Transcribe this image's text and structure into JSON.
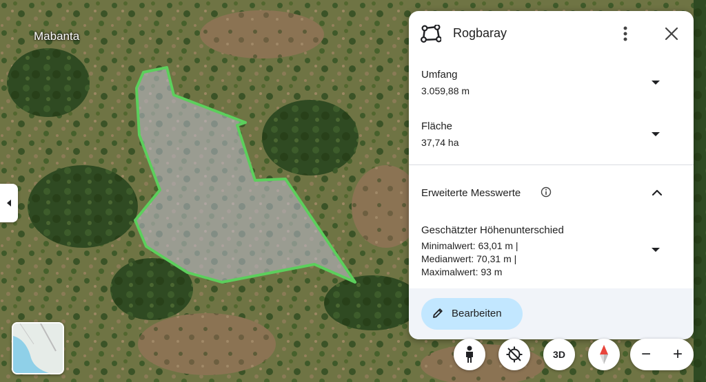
{
  "map": {
    "place_label": "Mabanta",
    "measurement_color": "#5ccf5c"
  },
  "panel": {
    "title": "Rogbaray",
    "icons": {
      "shape": "polygon-icon",
      "more": "more-vert-icon",
      "close": "close-icon"
    },
    "perimeter": {
      "label": "Umfang",
      "value": "3.059,88 m"
    },
    "area": {
      "label": "Fläche",
      "value": "37,74 ha"
    },
    "advanced": {
      "label": "Erweiterte Messwerte",
      "elevation": {
        "label": "Geschätzter Höhenunterschied",
        "min": "Minimalwert: 63,01 m |",
        "median": "Medianwert: 70,31 m |",
        "max": "Maximalwert: 93 m"
      }
    },
    "edit_label": "Bearbeiten",
    "accent_color": "#c2e7ff"
  },
  "controls": {
    "threed_label": "3D",
    "zoom_out": "−",
    "zoom_in": "+"
  }
}
